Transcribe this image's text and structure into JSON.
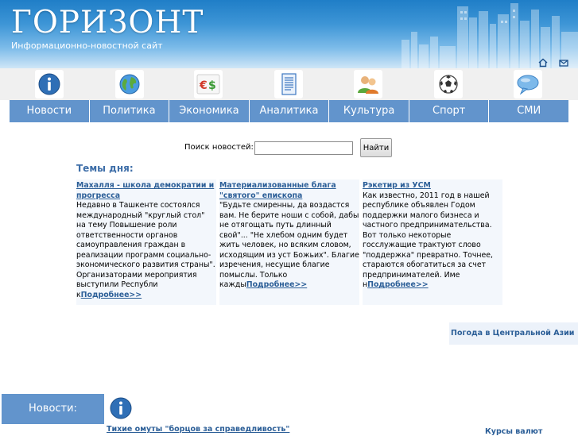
{
  "header": {
    "title": "ГОРИЗОНТ",
    "subtitle": "Информационно-новостной сайт",
    "icons": [
      "home-icon",
      "mail-icon"
    ]
  },
  "category_icons": [
    "info-icon",
    "globe-icon",
    "currency-icon",
    "document-icon",
    "people-icon",
    "soccer-ball-icon",
    "speech-bubble-icon"
  ],
  "nav": {
    "items": [
      {
        "label": "Новости"
      },
      {
        "label": "Политика"
      },
      {
        "label": "Экономика"
      },
      {
        "label": "Аналитика"
      },
      {
        "label": "Культура"
      },
      {
        "label": "Спорт"
      },
      {
        "label": "СМИ"
      }
    ]
  },
  "search": {
    "label": "Поиск новостей:",
    "value": "",
    "button": "Найти"
  },
  "topics": {
    "heading": "Темы дня:",
    "items": [
      {
        "title": "Махалля - школа демократии и прогресса",
        "body": "Недавно в Ташкенте состоялся международный \"круглый стол\" на тему Повышение роли ответственности органов самоуправления граждан в реализации программ социально-экономического развития страны\". Организаторами мероприятия выступили Республи к",
        "more": "Подробнее>>"
      },
      {
        "title": "Материализованные блага \"святого\" епископа",
        "body": "\"Будьте смиренны, да воздастся вам. Не берите ноши с собой, дабы не отягощать путь длинный свой\"... \"Не хлебом одним будет жить человек, но всяким словом, исходящим из уст Божьих\". Благие изречения, несущие благие помыслы. Только кажды",
        "more": "Подробнее>>"
      },
      {
        "title": "Рэкетир из УСМ",
        "body": "Как известно, 2011 год в нашей республике объявлен Годом поддержки малого бизнеса и частного предпринимательства. Вот только некоторые госслужащие трактуют слово \"поддержка\" превратно. Точнее, стараются обогатиться за счет предпринимателей. Име н",
        "more": "Подробнее>>"
      }
    ]
  },
  "weather": {
    "label": "Погода в Центральной Азии"
  },
  "news": {
    "heading": "Новости:",
    "icon": "info-icon",
    "first_link": "Тихие омуты \"борцов за справедливость\""
  },
  "currency": {
    "label": "Курсы валют"
  },
  "colors": {
    "nav_background": "#6294cc",
    "link": "#2b5e97",
    "heading": "#3e6ea8",
    "topic_background": "#f3f7fc"
  }
}
